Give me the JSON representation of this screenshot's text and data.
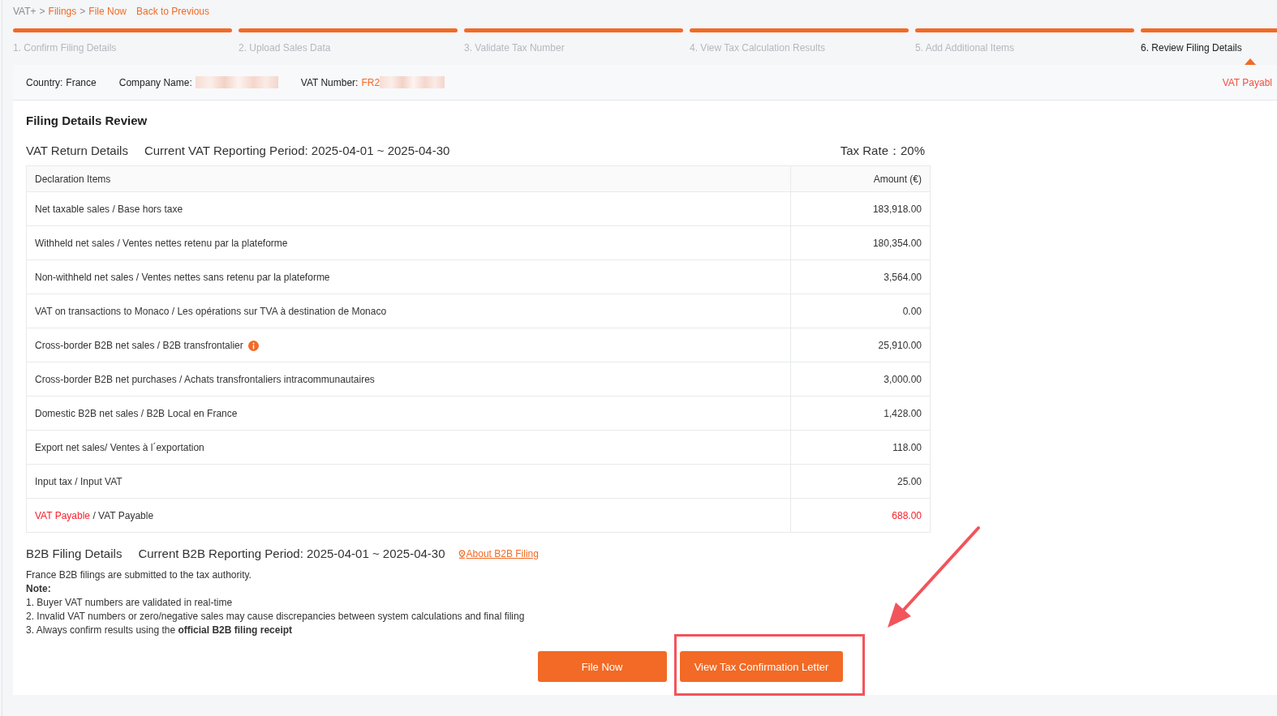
{
  "breadcrumb": [
    {
      "kind": "crumb",
      "label": "VAT+",
      "link": false
    },
    {
      "kind": "separator",
      "label": ">"
    },
    {
      "kind": "crumb",
      "label": "Filings",
      "link": true
    },
    {
      "kind": "separator",
      "label": ">"
    },
    {
      "kind": "crumb",
      "label": "File Now",
      "link": true
    }
  ],
  "back_link": "Back to Previous",
  "steps": [
    {
      "label": "1. Confirm Filing Details",
      "completed": true,
      "selected": false
    },
    {
      "label": "2. Upload Sales Data",
      "completed": true,
      "selected": false
    },
    {
      "label": "3. Validate Tax Number",
      "completed": true,
      "selected": false
    },
    {
      "label": "4. View Tax Calculation Results",
      "completed": true,
      "selected": false
    },
    {
      "label": "5. Add Additional Items",
      "completed": true,
      "selected": false
    },
    {
      "label": "6. Review Filing Details",
      "completed": true,
      "selected": true
    }
  ],
  "info_bar": {
    "fields": [
      {
        "kind": "text",
        "label": "Country:",
        "value": "France"
      },
      {
        "kind": "redacted",
        "label": "Company Name:"
      },
      {
        "kind": "masked",
        "label": "VAT Number:",
        "value": "FR2"
      }
    ],
    "right_note": "VAT Payabl"
  },
  "review": {
    "title": "Filing Details Review",
    "vat_section": {
      "title": "VAT Return Details",
      "period": "Current VAT Reporting Period: 2025-04-01 ~ 2025-04-30",
      "tax_rate": "Tax Rate：20%"
    }
  },
  "table": {
    "columns": [
      "Declaration Items",
      "Amount (€)"
    ],
    "rows": [
      {
        "item": "Net taxable sales / Base hors taxe",
        "amount": "183,918.00",
        "info": false,
        "highlight": false
      },
      {
        "item": "Withheld net sales / Ventes nettes retenu par la plateforme",
        "amount": "180,354.00",
        "info": false,
        "highlight": false
      },
      {
        "item": "Non-withheld net sales / Ventes nettes sans retenu par la plateforme",
        "amount": "3,564.00",
        "info": false,
        "highlight": false
      },
      {
        "item": "VAT on transactions to Monaco / Les opérations sur TVA à destination de Monaco",
        "amount": "0.00",
        "info": false,
        "highlight": false
      },
      {
        "item": "Cross-border B2B net sales / B2B transfrontalier",
        "amount": "25,910.00",
        "info": true,
        "highlight": false
      },
      {
        "item": "Cross-border B2B net purchases / Achats transfrontaliers intracommunautaires",
        "amount": "3,000.00",
        "info": false,
        "highlight": false
      },
      {
        "item": "Domestic B2B net sales / B2B Local en France",
        "amount": "1,428.00",
        "info": false,
        "highlight": false
      },
      {
        "item": "Export net sales/ Ventes à l´exportation",
        "amount": "118.00",
        "info": false,
        "highlight": false
      },
      {
        "item": "Input tax / Input VAT",
        "amount": "25.00",
        "info": false,
        "highlight": false
      },
      {
        "item": "VAT Payable",
        "item_rest": "/ VAT Payable",
        "amount": "688.00",
        "info": false,
        "highlight": true
      }
    ]
  },
  "b2b_section": {
    "title": "B2B Filing Details",
    "period": "Current B2B Reporting Period: 2025-04-01 ~ 2025-04-30",
    "link": "About B2B Filing",
    "intro": "France B2B filings are submitted to the tax authority.",
    "note_title": "Note:",
    "notes": [
      "1. Buyer VAT numbers are validated in real-time",
      "2. Invalid VAT numbers or zero/negative sales may cause discrepancies between system calculations and final filing",
      "3. Always confirm results using the **official B2B filing receipt**"
    ]
  },
  "buttons": [
    {
      "label": "File Now",
      "highlighted": false
    },
    {
      "label": "View Tax Confirmation Letter",
      "highlighted": true
    }
  ]
}
